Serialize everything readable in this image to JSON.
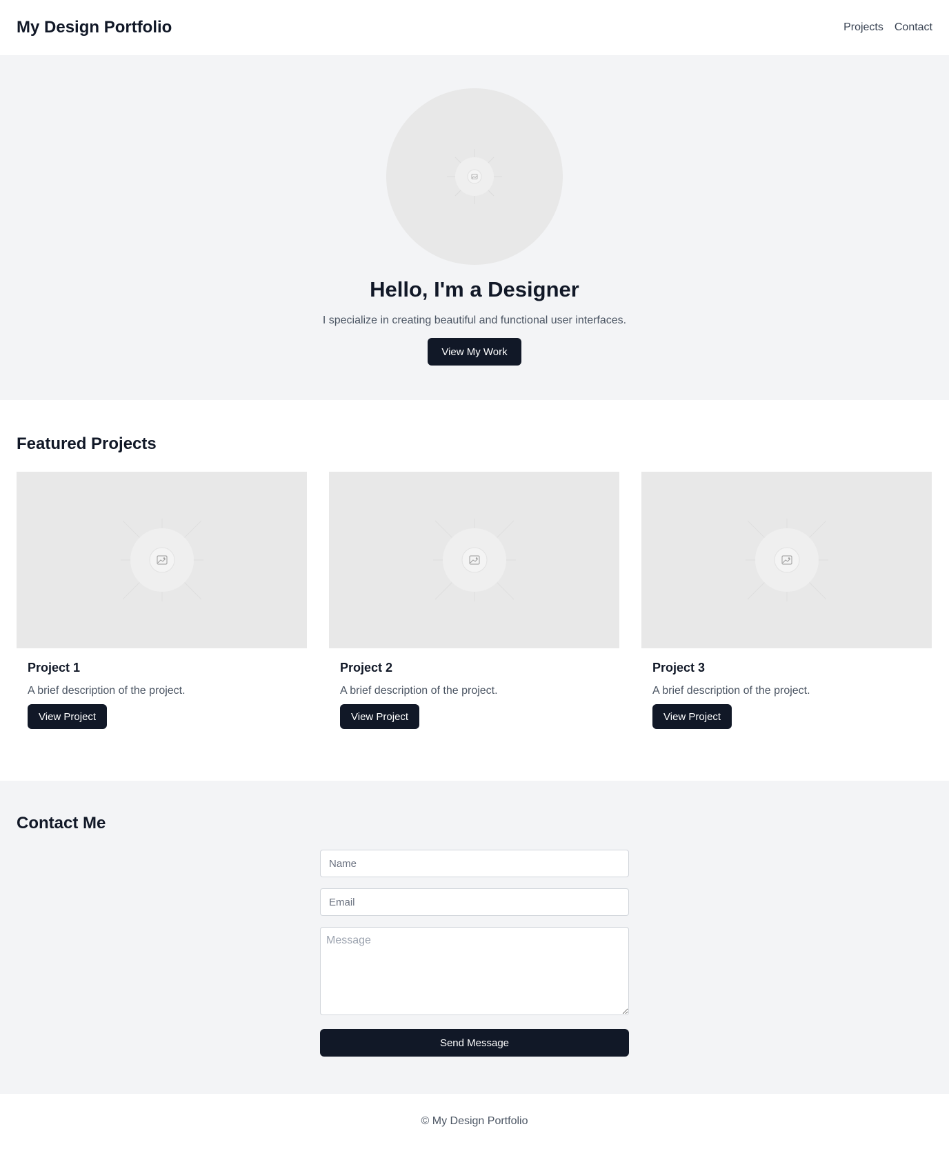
{
  "header": {
    "brand": "My Design Portfolio",
    "nav": [
      "Projects",
      "Contact"
    ]
  },
  "hero": {
    "image_icon": "image-placeholder-icon",
    "title": "Hello, I'm a Designer",
    "subtitle": "I specialize in creating beautiful and functional user interfaces.",
    "cta_label": "View My Work"
  },
  "projects": {
    "title": "Featured Projects",
    "items": [
      {
        "title": "Project 1",
        "description": "A brief description of the project.",
        "button_label": "View Project",
        "image_icon": "image-placeholder-icon"
      },
      {
        "title": "Project 2",
        "description": "A brief description of the project.",
        "button_label": "View Project",
        "image_icon": "image-placeholder-icon"
      },
      {
        "title": "Project 3",
        "description": "A brief description of the project.",
        "button_label": "View Project",
        "image_icon": "image-placeholder-icon"
      }
    ]
  },
  "contact": {
    "title": "Contact Me",
    "name_placeholder": "Name",
    "email_placeholder": "Email",
    "message_placeholder": "Message",
    "send_label": "Send Message"
  },
  "footer": {
    "text": "© My Design Portfolio"
  },
  "colors": {
    "dark": "#111827",
    "section_bg": "#f3f4f6",
    "placeholder_bg": "#e8e8e8",
    "muted_text": "#4b5563"
  }
}
